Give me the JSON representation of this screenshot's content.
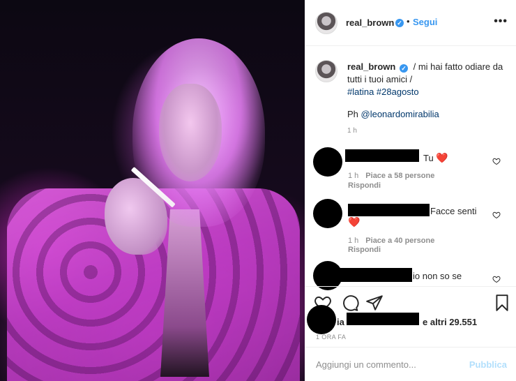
{
  "post": {
    "photo_alt": "photo"
  },
  "header": {
    "username": "real_brown",
    "dot": "•",
    "follow_label": "Segui",
    "more": "•••"
  },
  "caption": {
    "username": "real_brown",
    "text_line1": "/ mi hai fatto odiare da",
    "text_line2": "tutti i tuoi amici /",
    "hashtags": "#latina #28agosto",
    "credit_prefix": "Ph ",
    "credit_mention": "@leonardomirabilia",
    "time": "1 h"
  },
  "comments": [
    {
      "text": "Tu",
      "emoji": "❤️",
      "time": "1 h",
      "likes": "Piace a 58 persone",
      "reply": "Rispondi"
    },
    {
      "text": "Facce senti",
      "emoji": "❤️",
      "time": "1 h",
      "likes": "Piace a 40 persone",
      "reply": "Rispondi"
    },
    {
      "text": "io non so se"
    }
  ],
  "likes": {
    "prefix": "ia",
    "more": "e altri 29.551"
  },
  "posted_ago": "1 ORA FA",
  "add_comment": {
    "placeholder": "Aggiungi un commento...",
    "publish_label": "Pubblica"
  },
  "colors": {
    "accent": "#3897f0",
    "publish_disabled": "#b2dffc",
    "meta": "#8e8e8e"
  },
  "icons": {
    "verified": "verified-badge-icon",
    "heart": "heart-icon",
    "comment": "comment-icon",
    "share": "paper-plane-icon",
    "save": "bookmark-icon",
    "more": "ellipsis-icon"
  }
}
